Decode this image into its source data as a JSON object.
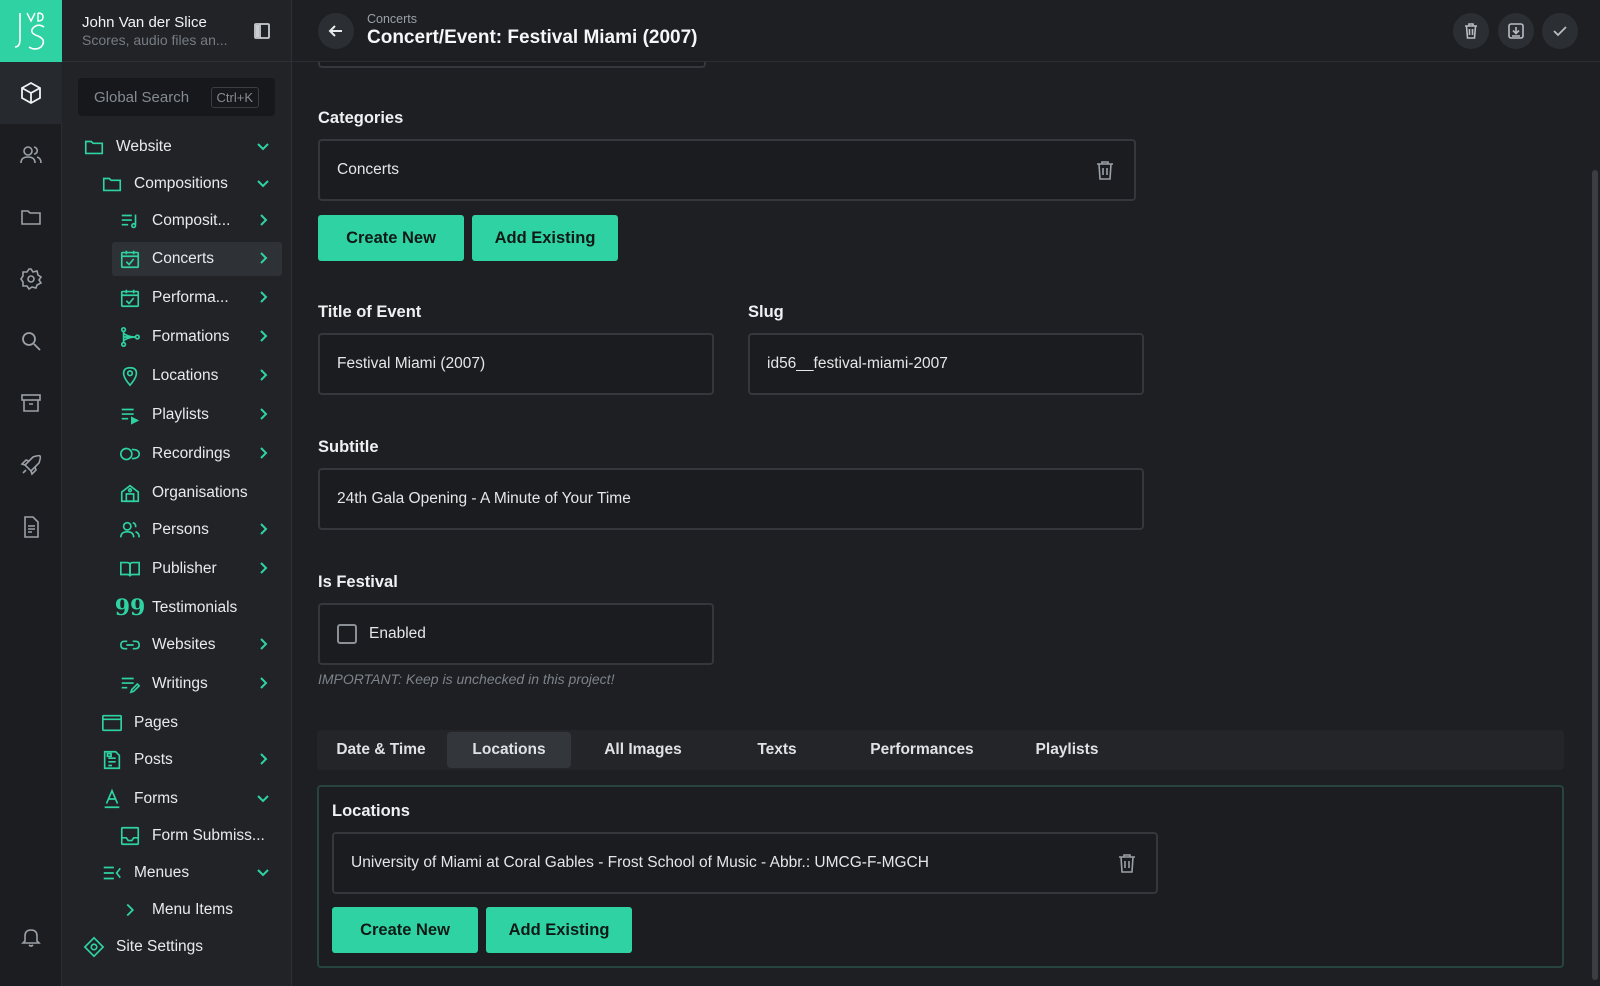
{
  "app": {
    "logo_text": "VDS",
    "user_name": "John Van der Slice",
    "user_desc": "Scores, audio files an...",
    "search_placeholder": "Global Search",
    "search_shortcut": "Ctrl+K"
  },
  "rail": [
    "content-icon",
    "users-icon",
    "folder-icon",
    "gear-icon",
    "search-icon",
    "archive-icon",
    "rocket-icon",
    "document-icon",
    "bell-icon"
  ],
  "tree": {
    "website": "Website",
    "compositions": "Compositions",
    "compositions_child": "Composit...",
    "concerts": "Concerts",
    "performances": "Performa...",
    "formations": "Formations",
    "locations": "Locations",
    "playlists": "Playlists",
    "recordings": "Recordings",
    "organisations": "Organisations",
    "persons": "Persons",
    "publisher": "Publisher",
    "testimonials": "Testimonials",
    "websites": "Websites",
    "writings": "Writings",
    "pages": "Pages",
    "posts": "Posts",
    "forms": "Forms",
    "form_submissions": "Form Submiss...",
    "menues": "Menues",
    "menu_items": "Menu Items",
    "site_settings": "Site Settings"
  },
  "header": {
    "breadcrumb": "Concerts",
    "title": "Concert/Event: Festival Miami (2007)"
  },
  "form": {
    "categories_label": "Categories",
    "categories_value": "Concerts",
    "create_new": "Create New",
    "add_existing": "Add Existing",
    "title_label": "Title of Event",
    "title_value": "Festival Miami (2007)",
    "slug_label": "Slug",
    "slug_value": "id56__festival-miami-2007",
    "subtitle_label": "Subtitle",
    "subtitle_value": "24th Gala Opening - A Minute of Your Time",
    "festival_label": "Is Festival",
    "festival_checkbox": "Enabled",
    "festival_hint": "IMPORTANT: Keep is unchecked in this project!"
  },
  "tabs": [
    "Date & Time",
    "Locations",
    "All Images",
    "Texts",
    "Performances",
    "Playlists"
  ],
  "active_tab": "Locations",
  "locations_panel": {
    "label": "Locations",
    "value": "University of Miami at Coral Gables - Frost School of Music - Abbr.: UMCG-F-MGCH",
    "create_new": "Create New",
    "add_existing": "Add Existing"
  },
  "colors": {
    "accent": "#2fd3a3",
    "background": "#1d1f22"
  }
}
